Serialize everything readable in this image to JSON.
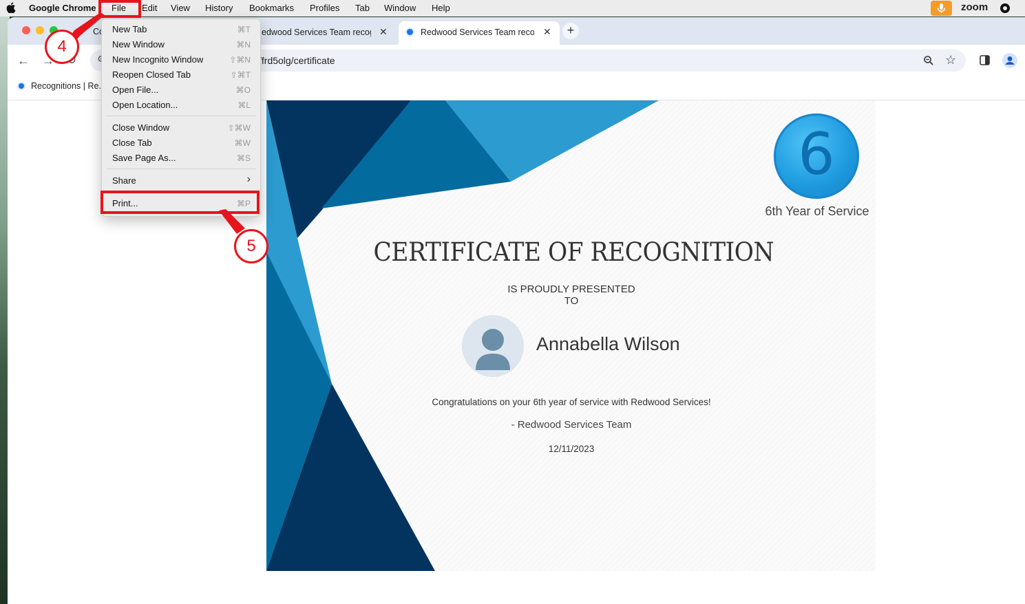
{
  "menubar": {
    "app_name": "Google Chrome",
    "items": [
      "File",
      "Edit",
      "View",
      "History",
      "Bookmarks",
      "Profiles",
      "Tab",
      "Window",
      "Help"
    ],
    "zoom": "zoom"
  },
  "tabs": {
    "first_partial": "Co",
    "second": "Redwood Services Team recog",
    "active": "Redwood Services Team recog",
    "new_tab": "+"
  },
  "address": {
    "url": "/frd5olg/certificate"
  },
  "bookmarks": {
    "item": "Recognitions | Re..."
  },
  "file_menu": {
    "items": [
      {
        "label": "New Tab",
        "shortcut": "⌘T"
      },
      {
        "label": "New Window",
        "shortcut": "⌘N"
      },
      {
        "label": "New Incognito Window",
        "shortcut": "⇧⌘N"
      },
      {
        "label": "Reopen Closed Tab",
        "shortcut": "⇧⌘T"
      },
      {
        "label": "Open File...",
        "shortcut": "⌘O"
      },
      {
        "label": "Open Location...",
        "shortcut": "⌘L"
      },
      {
        "label": "Close Window",
        "shortcut": "⇧⌘W"
      },
      {
        "label": "Close Tab",
        "shortcut": "⌘W"
      },
      {
        "label": "Save Page As...",
        "shortcut": "⌘S"
      },
      {
        "label": "Share",
        "shortcut": "›"
      },
      {
        "label": "Print...",
        "shortcut": "⌘P"
      }
    ]
  },
  "certificate": {
    "badge_number": "6",
    "badge_label": "6th Year of Service",
    "title": "CERTIFICATE OF RECOGNITION",
    "subtitle": "IS PROUDLY PRESENTED TO",
    "recipient": "Annabella Wilson",
    "message": "Congratulations on your 6th year of service with Redwood Services!",
    "signature": "- Redwood Services Team",
    "date": "12/11/2023",
    "colors": {
      "dark": "#033460",
      "mid": "#046b9e",
      "light": "#2b9bd0"
    }
  },
  "annotations": {
    "step_file": "4",
    "step_print": "5",
    "color": "#e8141b"
  }
}
